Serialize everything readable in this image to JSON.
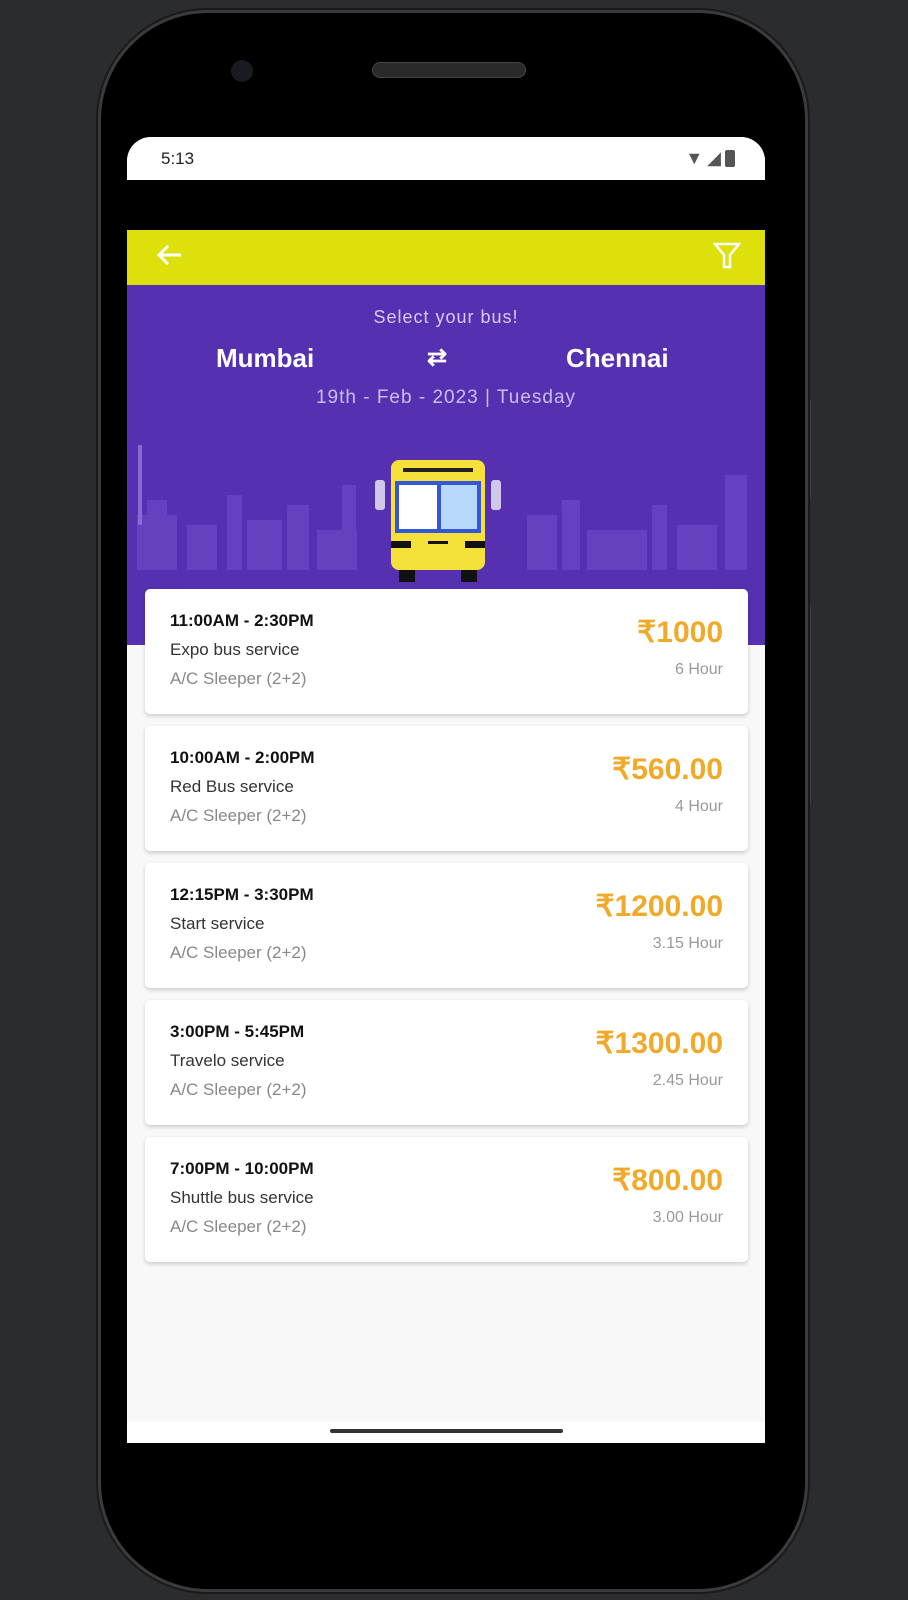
{
  "status_bar": {
    "time": "5:13"
  },
  "header": {
    "subtitle": "Select your bus!",
    "from": "Mumbai",
    "to": "Chennai",
    "date": "19th - Feb - 2023 | Tuesday"
  },
  "colors": {
    "appbar": "#dde00a",
    "hero": "#5530b0",
    "price": "#f0a928"
  },
  "buses": [
    {
      "time": "11:00AM - 2:30PM",
      "name": "Expo bus service",
      "type": "A/C Sleeper (2+2)",
      "price": "₹1000",
      "duration": "6 Hour"
    },
    {
      "time": "10:00AM - 2:00PM",
      "name": "Red Bus service",
      "type": "A/C Sleeper (2+2)",
      "price": "₹560.00",
      "duration": "4 Hour"
    },
    {
      "time": "12:15PM - 3:30PM",
      "name": "Start service",
      "type": "A/C Sleeper (2+2)",
      "price": "₹1200.00",
      "duration": "3.15 Hour"
    },
    {
      "time": "3:00PM - 5:45PM",
      "name": "Travelo service",
      "type": "A/C Sleeper (2+2)",
      "price": "₹1300.00",
      "duration": "2.45 Hour"
    },
    {
      "time": "7:00PM - 10:00PM",
      "name": "Shuttle bus service",
      "type": "A/C Sleeper (2+2)",
      "price": "₹800.00",
      "duration": "3.00 Hour"
    }
  ]
}
